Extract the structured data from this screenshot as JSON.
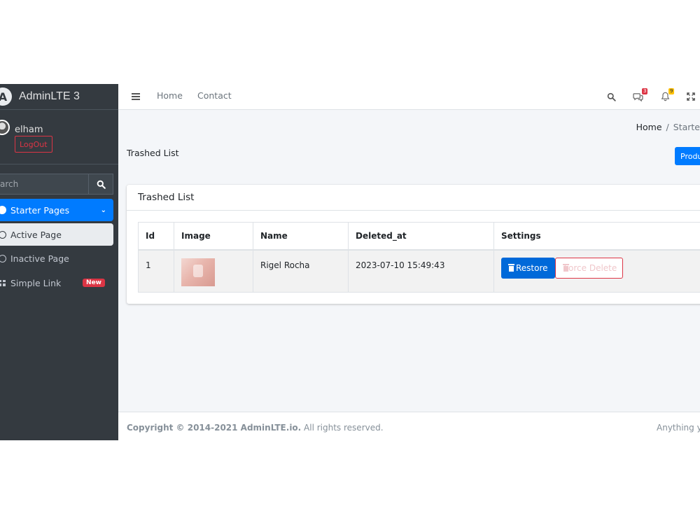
{
  "brand": {
    "name": "AdminLTE 3"
  },
  "user": {
    "name": "elham",
    "logout_label": "LogOut"
  },
  "sidebar": {
    "search_placeholder": "arch",
    "items": [
      {
        "label": "Starter Pages"
      },
      {
        "label": "Active Page"
      },
      {
        "label": "Inactive Page"
      },
      {
        "label": "Simple Link",
        "badge": "New"
      }
    ]
  },
  "topbar": {
    "links": [
      "Home",
      "Contact"
    ],
    "messages_count": "3",
    "notifications_count": "9"
  },
  "breadcrumb": {
    "home": "Home",
    "separator": "/",
    "current": "Starte"
  },
  "page": {
    "title": "Trashed List",
    "products_button": "Produ"
  },
  "card": {
    "title": "Trashed List"
  },
  "table": {
    "headers": [
      "Id",
      "Image",
      "Name",
      "Deleted_at",
      "Settings"
    ],
    "rows": [
      {
        "id": "1",
        "name": "Rigel Rocha",
        "deleted_at": "2023-07-10 15:49:43",
        "restore_label": "Restore",
        "force_delete_label": "Force Delete"
      }
    ]
  },
  "footer": {
    "copyright_bold": "Copyright © 2014-2021 AdminLTE.io.",
    "copyright_rest": " All rights reserved.",
    "right_text": "Anything yo"
  },
  "colors": {
    "primary": "#007bff",
    "danger": "#dc3545",
    "sidebar_bg": "#343a40",
    "warning": "#ffc107"
  }
}
